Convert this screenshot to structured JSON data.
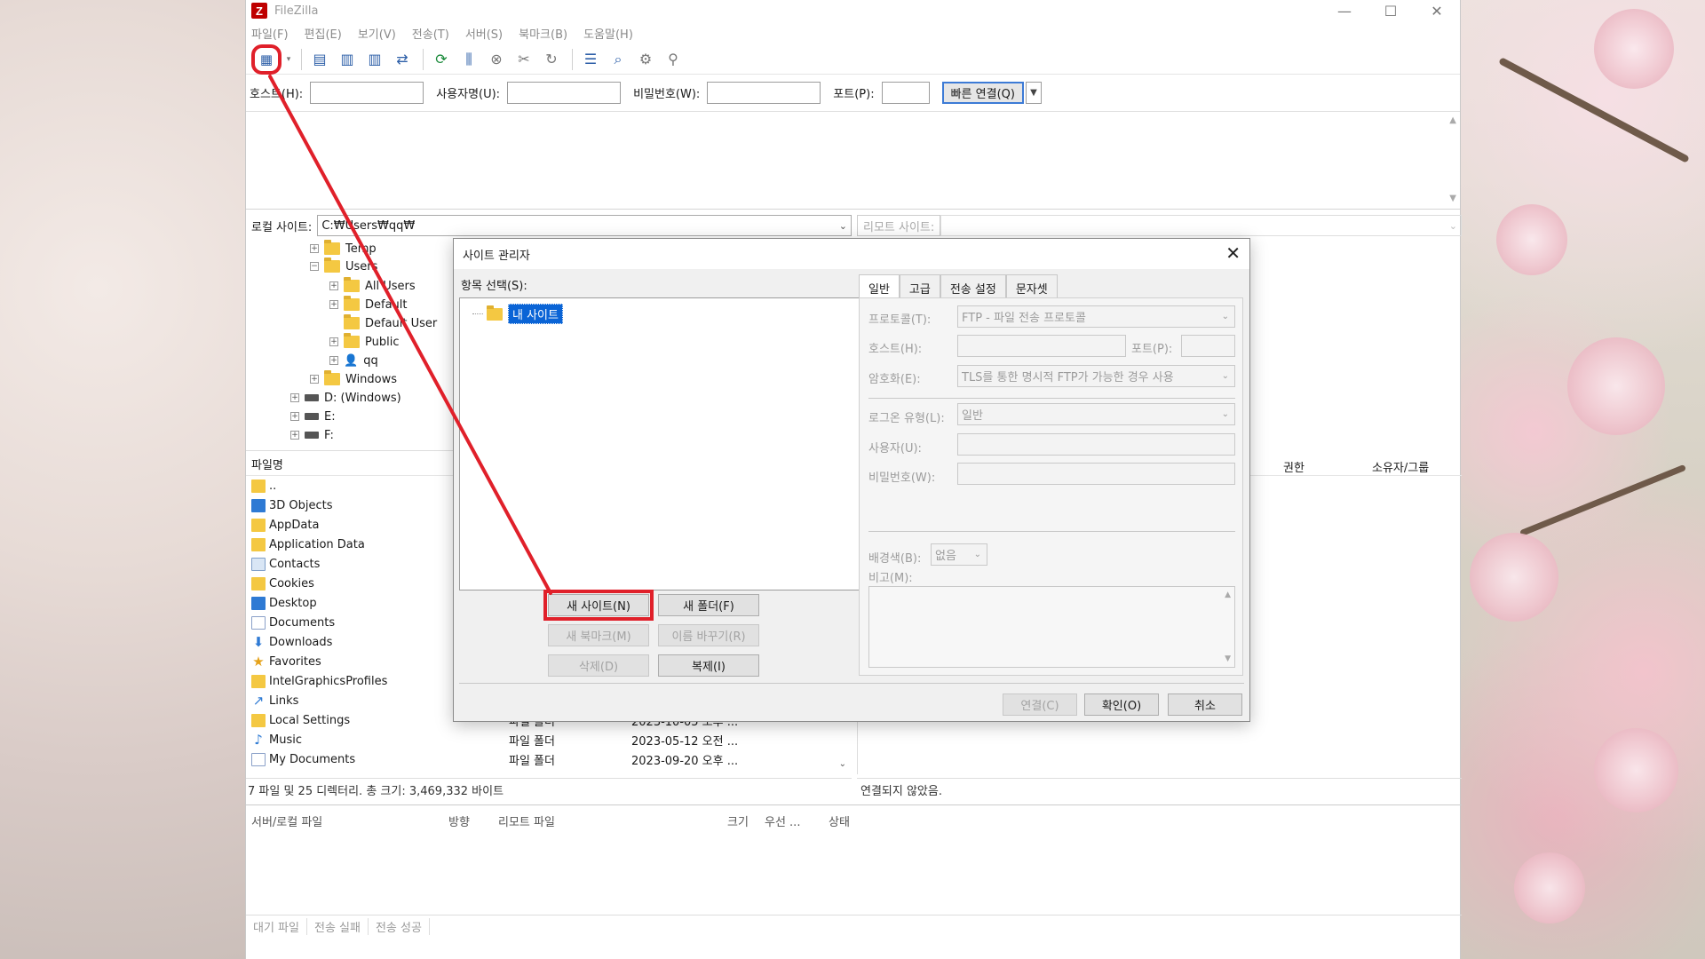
{
  "window": {
    "title": "FileZilla",
    "minimize": "—",
    "maximize": "☐",
    "close": "✕"
  },
  "menu": [
    "파일(F)",
    "편집(E)",
    "보기(V)",
    "전송(T)",
    "서버(S)",
    "북마크(B)",
    "도움말(H)"
  ],
  "quickconnect": {
    "host_label": "호스트(H):",
    "user_label": "사용자명(U):",
    "pass_label": "비밀번호(W):",
    "port_label": "포트(P):",
    "button": "빠른 연결(Q)",
    "host_value": "",
    "user_value": "",
    "pass_value": "",
    "port_value": ""
  },
  "local_site": {
    "label": "로컬 사이트:",
    "path": "C:₩Users₩qq₩"
  },
  "remote_site": {
    "label": "리모트 사이트:",
    "path": ""
  },
  "tree": [
    {
      "label": "Temp"
    },
    {
      "label": "Users"
    },
    {
      "label": "All Users"
    },
    {
      "label": "Default"
    },
    {
      "label": "Default User"
    },
    {
      "label": "Public"
    },
    {
      "label": "qq"
    },
    {
      "label": "Windows"
    },
    {
      "label": "D: (Windows)"
    },
    {
      "label": "E:"
    },
    {
      "label": "F:"
    }
  ],
  "file_list": {
    "col_name": "파일명",
    "rows": [
      {
        "name": "..",
        "type": "",
        "date": ""
      },
      {
        "name": "3D Objects",
        "type": "",
        "date": ""
      },
      {
        "name": "AppData",
        "type": "",
        "date": ""
      },
      {
        "name": "Application Data",
        "type": "",
        "date": ""
      },
      {
        "name": "Contacts",
        "type": "",
        "date": ""
      },
      {
        "name": "Cookies",
        "type": "",
        "date": ""
      },
      {
        "name": "Desktop",
        "type": "",
        "date": ""
      },
      {
        "name": "Documents",
        "type": "",
        "date": ""
      },
      {
        "name": "Downloads",
        "type": "",
        "date": ""
      },
      {
        "name": "Favorites",
        "type": "",
        "date": ""
      },
      {
        "name": "IntelGraphicsProfiles",
        "type": "",
        "date": ""
      },
      {
        "name": "Links",
        "type": "",
        "date": ""
      },
      {
        "name": "Local Settings",
        "type": "파일 폴더",
        "date": "2023-10-05 오후 ..."
      },
      {
        "name": "Music",
        "type": "파일 폴더",
        "date": "2023-05-12 오전 ..."
      },
      {
        "name": "My Documents",
        "type": "파일 폴더",
        "date": "2023-09-20 오후 ..."
      }
    ]
  },
  "remote_list": {
    "col_perm": "권한",
    "col_owner": "소유자/그룹"
  },
  "status": {
    "local": "7 파일 및 25 디렉터리. 총 크기: 3,469,332 바이트",
    "remote": "연결되지 않았음."
  },
  "queue": {
    "col_file": "서버/로컬 파일",
    "col_dir": "방향",
    "col_remote": "리모트 파일",
    "col_size": "크기",
    "col_prio": "우선 ...",
    "col_state": "상태",
    "tabs": [
      "대기 파일",
      "전송 실패",
      "전송 성공"
    ]
  },
  "dialog": {
    "title": "사이트 관리자",
    "select_label": "항목 선택(S):",
    "tree_root": "내 사이트",
    "buttons": {
      "new_site": "새 사이트(N)",
      "new_folder": "새 폴더(F)",
      "new_bookmark": "새 북마크(M)",
      "rename": "이름 바꾸기(R)",
      "delete": "삭제(D)",
      "duplicate": "복제(I)"
    },
    "tabs": [
      "일반",
      "고급",
      "전송 설정",
      "문자셋"
    ],
    "general": {
      "protocol_label": "프로토콜(T):",
      "protocol_value": "FTP - 파일 전송 프로토콜",
      "host_label": "호스트(H):",
      "port_label": "포트(P):",
      "encryption_label": "암호화(E):",
      "encryption_value": "TLS를 통한 명시적 FTP가 가능한 경우 사용",
      "logon_label": "로그온 유형(L):",
      "logon_value": "일반",
      "user_label": "사용자(U):",
      "password_label": "비밀번호(W):",
      "bgcolor_label": "배경색(B):",
      "bgcolor_value": "없음",
      "comment_label": "비고(M):"
    },
    "footer": {
      "connect": "연결(C)",
      "ok": "확인(O)",
      "cancel": "취소"
    }
  },
  "accent": {
    "annotation": "#e0202a",
    "selection": "#0a64d6"
  }
}
